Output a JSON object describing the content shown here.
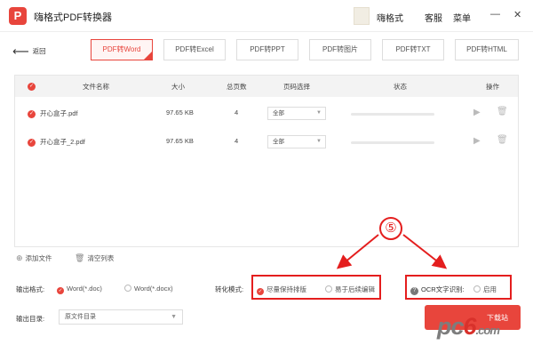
{
  "app": {
    "logo_letter": "P",
    "title": "嗨格式PDF转换器"
  },
  "header": {
    "user_name": "嗨格式",
    "service_label": "客服",
    "menu_label": "菜单",
    "minimize_label": "—",
    "close_label": "✕"
  },
  "nav": {
    "back_label": "返回"
  },
  "format_tabs": [
    {
      "label": "PDF转Word",
      "active": true
    },
    {
      "label": "PDF转Excel",
      "active": false
    },
    {
      "label": "PDF转PPT",
      "active": false
    },
    {
      "label": "PDF转图片",
      "active": false
    },
    {
      "label": "PDF转TXT",
      "active": false
    },
    {
      "label": "PDF转HTML",
      "active": false
    }
  ],
  "table": {
    "columns": {
      "name": "文件名称",
      "size": "大小",
      "pages": "总页数",
      "page_select": "页码选择",
      "status": "状态",
      "actions": "操作"
    },
    "rows": [
      {
        "name": "开心盒子.pdf",
        "size": "97.65 KB",
        "pages": "4",
        "page_select": "全部",
        "progress": 0
      },
      {
        "name": "开心盒子_2.pdf",
        "size": "97.65 KB",
        "pages": "4",
        "page_select": "全部",
        "progress": 0
      }
    ]
  },
  "footer_actions": {
    "add_file": "添加文件",
    "clear_list": "清空列表"
  },
  "options": {
    "output_format_label": "输出格式:",
    "format_doc": "Word(*.doc)",
    "format_docx": "Word(*.docx)",
    "convert_mode_label": "转化模式:",
    "mode_keep_layout": "尽量保持排版",
    "mode_editable": "易于后续编辑",
    "ocr_label": "OCR文字识别:",
    "ocr_enable": "启用",
    "output_dir_label": "输出目录:",
    "output_dir_value": "原文件目录"
  },
  "annotation": {
    "step_number": "⑤"
  },
  "watermark": {
    "text_main": "pc",
    "text_six": "6",
    "text_end": ".com",
    "sub": "下载站"
  },
  "colors": {
    "accent": "#e8453c",
    "annotation_red": "#e41e1e"
  }
}
